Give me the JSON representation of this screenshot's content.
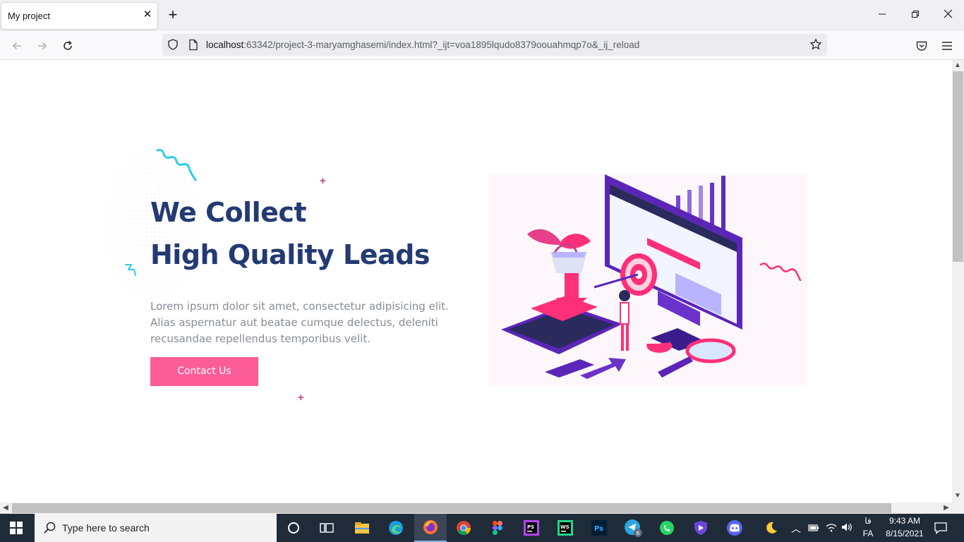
{
  "browser": {
    "tab_title": "My project",
    "url_host": "localhost",
    "url_rest": ":63342/project-3-maryamghasemi/index.html?_ijt=voa1895lqudo8379oouahmqp7o&_ij_reload"
  },
  "hero": {
    "title_line1": "We Collect",
    "title_line2": "High Quality Leads",
    "description": "Lorem ipsum dolor sit amet, consectetur adipisicing elit. Alias aspernatur aut beatae cumque delectus, deleniti recusandae repellendus temporibus velit.",
    "cta_label": "Contact Us"
  },
  "taskbar": {
    "search_placeholder": "Type here to search",
    "time": "9:43 AM",
    "date": "8/15/2021",
    "lang_top": "فا",
    "lang_bottom": "FA",
    "telegram_badge": "6"
  },
  "colors": {
    "heading": "#233a72",
    "cta": "#fd5d97",
    "accent_cyan": "#2ecbe6",
    "accent_pink": "#c43f8c"
  },
  "icons": [
    "back-icon",
    "forward-icon",
    "reload-icon",
    "shield-icon",
    "page-icon",
    "star-icon",
    "pocket-icon",
    "menu-icon",
    "windows-icon",
    "search-icon",
    "cortana-icon",
    "task-view-icon",
    "file-explorer-icon",
    "edge-icon",
    "firefox-icon",
    "chrome-icon",
    "figma-icon",
    "phpstorm-icon",
    "webstorm-icon",
    "photoshop-icon",
    "telegram-icon",
    "whatsapp-icon",
    "vpn-icon",
    "discord-icon",
    "moon-icon",
    "notification-icon"
  ]
}
